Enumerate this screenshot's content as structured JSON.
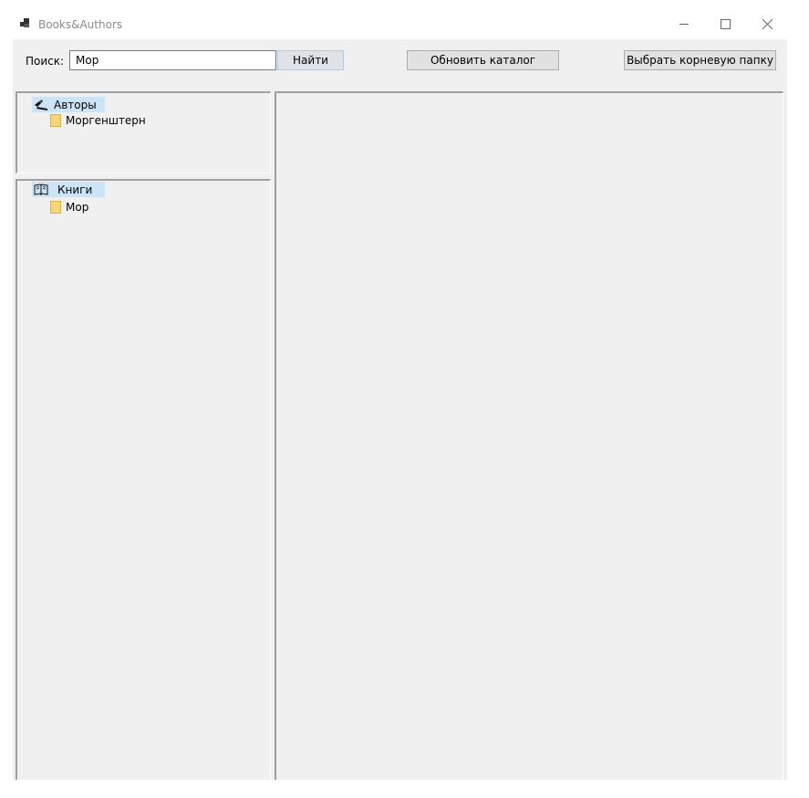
{
  "window": {
    "title": "Books&Authors"
  },
  "toolbar": {
    "search_label": "Поиск:",
    "search_value": "Мор",
    "find_label": "Найти",
    "refresh_label": "Обновить каталог",
    "choose_root_label": "Выбрать корневую папку"
  },
  "authors_tree": {
    "root_label": "Авторы",
    "root_icon": "quill-icon",
    "children": [
      {
        "label": "Моргенштерн",
        "icon": "folder-icon"
      }
    ]
  },
  "books_tree": {
    "root_label": "Книги",
    "root_icon": "book-icon",
    "children": [
      {
        "label": "Мор",
        "icon": "folder-icon"
      }
    ]
  },
  "colors": {
    "selection": "#cce4f7",
    "panel_bg": "#f0f0f0",
    "folder": "#f7d774"
  }
}
